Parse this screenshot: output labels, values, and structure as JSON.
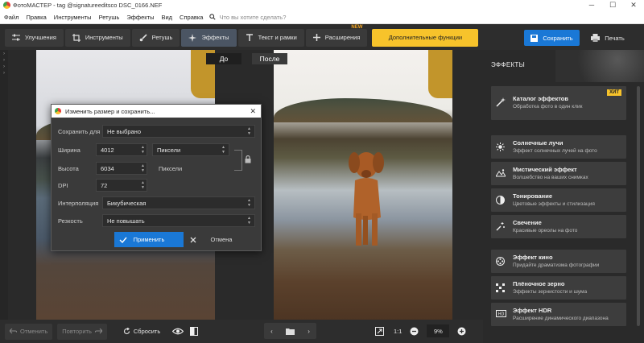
{
  "window": {
    "title": "ФотоМАСТЕР - tag @signatureeditsco DSC_0166.NEF"
  },
  "menu": {
    "items": [
      "Файл",
      "Правка",
      "Инструменты",
      "Ретушь",
      "Эффекты",
      "Вид",
      "Справка"
    ],
    "search_placeholder": "Что вы хотите сделать?"
  },
  "toolbar": {
    "improve": "Улучшения",
    "tools": "Инструменты",
    "retouch": "Ретушь",
    "effects": "Эффекты",
    "text": "Текст и рамки",
    "extensions": "Расширения",
    "new_badge": "NEW",
    "extra": "Дополнительные функции",
    "save": "Сохранить",
    "print": "Печать"
  },
  "compare": {
    "before": "До",
    "after": "После"
  },
  "dialog": {
    "title": "Изменить размер и сохранить...",
    "save_for_label": "Сохранить для",
    "save_for_value": "Не выбрано",
    "width_label": "Ширина",
    "width_value": "4012",
    "height_label": "Высота",
    "height_value": "6034",
    "units_value": "Пиксели",
    "units_static": "Пиксели",
    "dpi_label": "DPI",
    "dpi_value": "72",
    "interp_label": "Интерполяция",
    "interp_value": "Бикубическая",
    "sharp_label": "Резкость",
    "sharp_value": "Не повышать",
    "apply": "Применить",
    "cancel": "Отмена"
  },
  "effects_panel": {
    "title": "ЭФФЕКТЫ",
    "hit_badge": "ХИТ",
    "cards": [
      {
        "title": "Каталог эффектов",
        "subtitle": "Обработка фото в один клик",
        "icon": "magic-wand-icon"
      },
      {
        "title": "Солнечные лучи",
        "subtitle": "Эффект солнечных лучей на фото",
        "icon": "sun-icon"
      },
      {
        "title": "Мистический эффект",
        "subtitle": "Волшебство на ваших снимках",
        "icon": "mystic-icon"
      },
      {
        "title": "Тонирование",
        "subtitle": "Цветовые эффекты и стилизация",
        "icon": "toning-icon"
      },
      {
        "title": "Свечение",
        "subtitle": "Красивые ореолы на фото",
        "icon": "glow-icon"
      },
      {
        "title": "Эффект кино",
        "subtitle": "Придайте драматизма фотографии",
        "icon": "film-reel-icon"
      },
      {
        "title": "Плёночное зерно",
        "subtitle": "Эффекты зернистости и шума",
        "icon": "grain-icon"
      },
      {
        "title": "Эффект HDR",
        "subtitle": "Расширение динамического диапазона",
        "icon": "hdr-icon"
      }
    ]
  },
  "bottom": {
    "undo": "Отменить",
    "redo": "Повторить",
    "reset": "Сбросить",
    "ratio": "1:1",
    "zoom": "9%"
  },
  "colors": {
    "accent": "#1a78d6",
    "highlight": "#f7c32b",
    "panel": "#3d3d3d"
  }
}
